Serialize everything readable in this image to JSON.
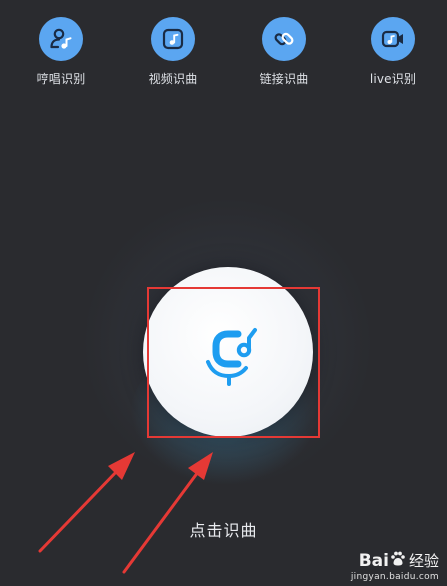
{
  "top_bar": {
    "items": [
      {
        "label": "哼唱识别",
        "icon": "hum-person-icon"
      },
      {
        "label": "视频识曲",
        "icon": "video-music-icon"
      },
      {
        "label": "链接识曲",
        "icon": "link-icon"
      },
      {
        "label": "live识别",
        "icon": "live-camera-icon"
      }
    ]
  },
  "main": {
    "record_icon": "microphone-music-icon",
    "tap_label": "点击识曲"
  },
  "watermark": {
    "brand_left": "Bai",
    "brand_right": "经验",
    "url": "jingyan.baidu.com"
  },
  "colors": {
    "background": "#2a2b2f",
    "icon_circle": "#5ba6f1",
    "accent_blue": "#1e9df0",
    "annotation_red": "#e53935"
  }
}
